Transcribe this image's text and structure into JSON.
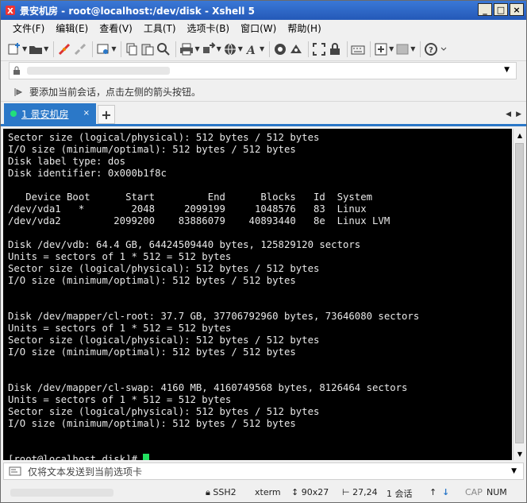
{
  "window": {
    "title": "景安机房 - root@localhost:/dev/disk - Xshell 5",
    "minimize": "_",
    "maximize": "□",
    "close": "×"
  },
  "menu": [
    "文件(F)",
    "编辑(E)",
    "查看(V)",
    "工具(T)",
    "选项卡(B)",
    "窗口(W)",
    "帮助(H)"
  ],
  "hint": {
    "text": "要添加当前会话，点击左侧的箭头按钮。"
  },
  "tabs": [
    {
      "label": "1 景安机房",
      "close": "×"
    }
  ],
  "tab_add": "+",
  "terminal": {
    "lines": [
      "Sector size (logical/physical): 512 bytes / 512 bytes",
      "I/O size (minimum/optimal): 512 bytes / 512 bytes",
      "Disk label type: dos",
      "Disk identifier: 0x000b1f8c",
      "",
      "   Device Boot      Start         End      Blocks   Id  System",
      "/dev/vda1   *        2048     2099199     1048576   83  Linux",
      "/dev/vda2         2099200    83886079    40893440   8e  Linux LVM",
      "",
      "Disk /dev/vdb: 64.4 GB, 64424509440 bytes, 125829120 sectors",
      "Units = sectors of 1 * 512 = 512 bytes",
      "Sector size (logical/physical): 512 bytes / 512 bytes",
      "I/O size (minimum/optimal): 512 bytes / 512 bytes",
      "",
      "",
      "Disk /dev/mapper/cl-root: 37.7 GB, 37706792960 bytes, 73646080 sectors",
      "Units = sectors of 1 * 512 = 512 bytes",
      "Sector size (logical/physical): 512 bytes / 512 bytes",
      "I/O size (minimum/optimal): 512 bytes / 512 bytes",
      "",
      "",
      "Disk /dev/mapper/cl-swap: 4160 MB, 4160749568 bytes, 8126464 sectors",
      "Units = sectors of 1 * 512 = 512 bytes",
      "Sector size (logical/physical): 512 bytes / 512 bytes",
      "I/O size (minimum/optimal): 512 bytes / 512 bytes",
      "",
      ""
    ],
    "prompt": "[root@localhost disk]# "
  },
  "sendbar": {
    "text": "仅将文本发送到当前选项卡"
  },
  "status": {
    "protocol": "SSH2",
    "term": "xterm",
    "size": "90x27",
    "cursor": "27,24",
    "sessions": "1 会话",
    "cap": "CAP",
    "num": "NUM"
  },
  "colors": {
    "accent": "#2b78c8",
    "terminal_bg": "#000000",
    "terminal_fg": "#e8e8e8",
    "cursor": "#22e060"
  }
}
